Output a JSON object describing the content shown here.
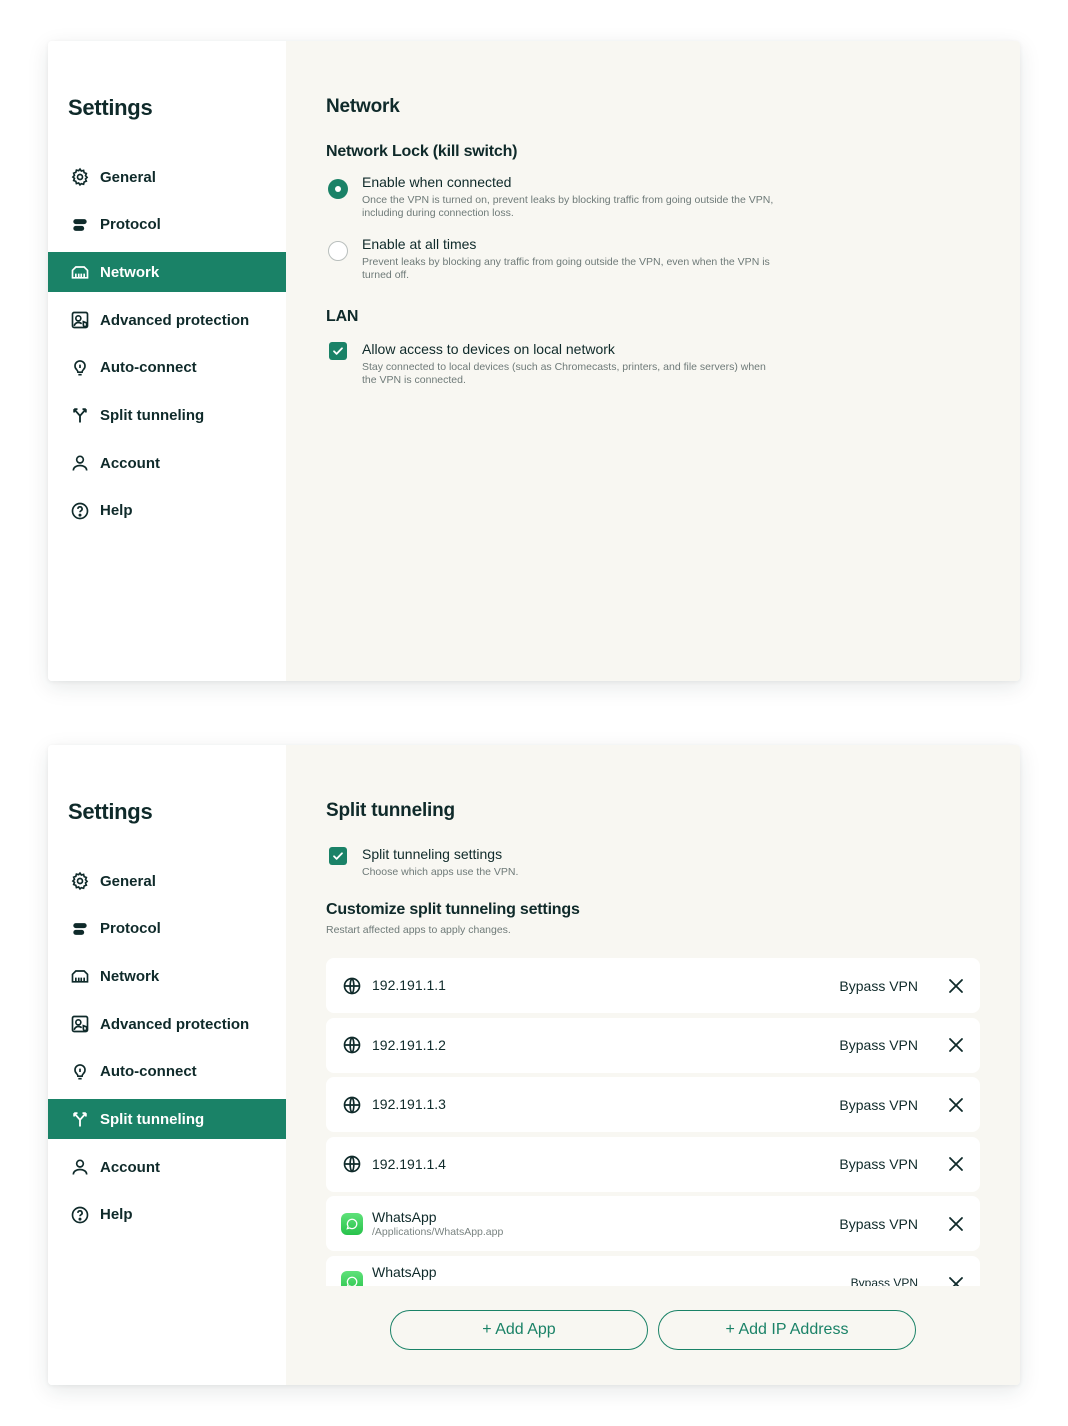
{
  "colors": {
    "accent": "#1a8267",
    "content_bg": "#f8f7f2",
    "text": "#0f2a2a"
  },
  "panel1": {
    "sidebar": {
      "title": "Settings",
      "items": [
        {
          "label": "General",
          "icon": "gear-icon"
        },
        {
          "label": "Protocol",
          "icon": "protocol-icon"
        },
        {
          "label": "Network",
          "icon": "network-icon",
          "active": true
        },
        {
          "label": "Advanced protection",
          "icon": "shield-person-icon"
        },
        {
          "label": "Auto-connect",
          "icon": "bulb-icon"
        },
        {
          "label": "Split tunneling",
          "icon": "split-icon"
        },
        {
          "label": "Account",
          "icon": "user-icon"
        },
        {
          "label": "Help",
          "icon": "help-icon"
        }
      ]
    },
    "content": {
      "title": "Network",
      "kill_switch": {
        "heading": "Network Lock (kill switch)",
        "options": [
          {
            "title": "Enable when connected",
            "desc": "Once the VPN is turned on, prevent leaks by blocking traffic from going outside the VPN, including during connection loss.",
            "selected": true
          },
          {
            "title": "Enable at all times",
            "desc": "Prevent leaks by blocking any traffic from going outside the VPN, even when the VPN is turned off.",
            "selected": false
          }
        ]
      },
      "lan": {
        "heading": "LAN",
        "option": {
          "title": "Allow access to devices on local network",
          "desc": "Stay connected to local devices (such as Chromecasts, printers, and file servers) when the VPN is connected.",
          "checked": true
        }
      }
    }
  },
  "panel2": {
    "sidebar": {
      "title": "Settings",
      "items": [
        {
          "label": "General",
          "icon": "gear-icon"
        },
        {
          "label": "Protocol",
          "icon": "protocol-icon"
        },
        {
          "label": "Network",
          "icon": "network-icon"
        },
        {
          "label": "Advanced protection",
          "icon": "shield-person-icon"
        },
        {
          "label": "Auto-connect",
          "icon": "bulb-icon"
        },
        {
          "label": "Split tunneling",
          "icon": "split-icon",
          "active": true
        },
        {
          "label": "Account",
          "icon": "user-icon"
        },
        {
          "label": "Help",
          "icon": "help-icon"
        }
      ]
    },
    "content": {
      "title": "Split tunneling",
      "toggle": {
        "title": "Split tunneling settings",
        "desc": "Choose which apps use the VPN.",
        "checked": true
      },
      "customize": {
        "heading": "Customize split tunneling settings",
        "desc": "Restart affected apps to apply changes."
      },
      "rows": [
        {
          "name": "192.191.1.1",
          "mode": "Bypass VPN",
          "icon": "globe-icon"
        },
        {
          "name": "192.191.1.2",
          "mode": "Bypass VPN",
          "icon": "globe-icon"
        },
        {
          "name": "192.191.1.3",
          "mode": "Bypass VPN",
          "icon": "globe-icon"
        },
        {
          "name": "192.191.1.4",
          "mode": "Bypass VPN",
          "icon": "globe-icon"
        },
        {
          "name": "WhatsApp",
          "path": "/Applications/WhatsApp.app",
          "mode": "Bypass VPN",
          "icon": "whatsapp-icon"
        },
        {
          "name": "WhatsApp",
          "mode": "Bypass VPN",
          "icon": "whatsapp-icon"
        }
      ],
      "add_app_label": "+ Add App",
      "add_ip_label": "+ Add IP Address"
    }
  }
}
